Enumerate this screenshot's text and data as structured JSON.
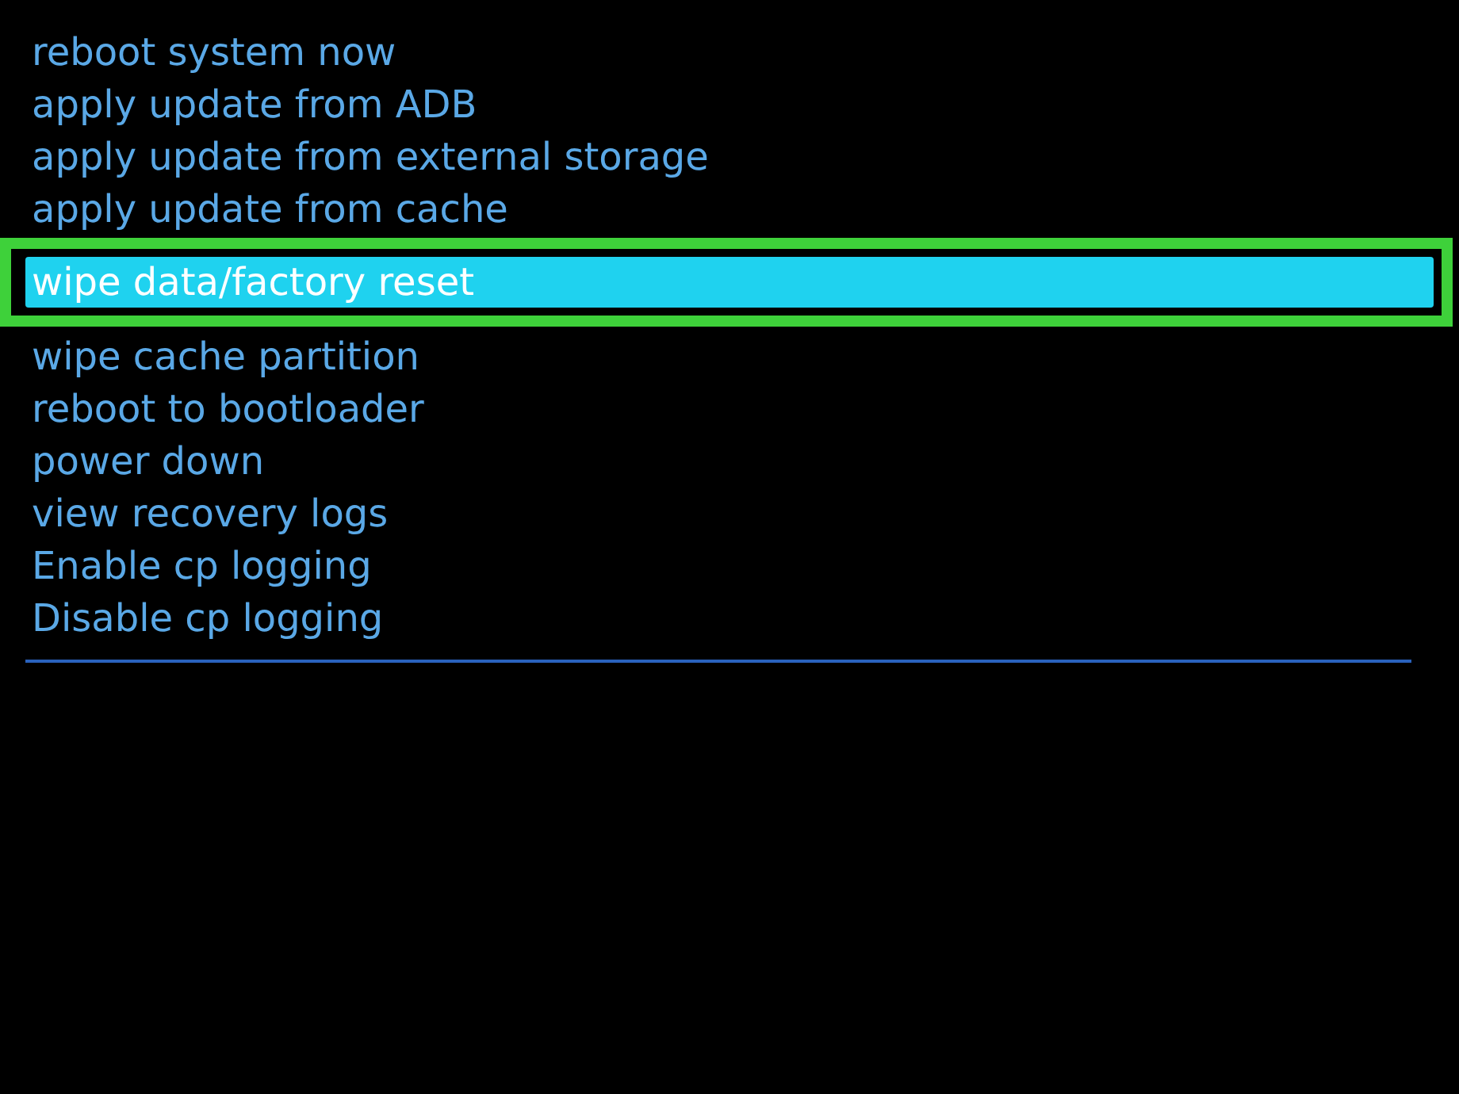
{
  "menu": {
    "items": [
      {
        "label": "reboot system now",
        "selected": false
      },
      {
        "label": "apply update from ADB",
        "selected": false
      },
      {
        "label": "apply update from external storage",
        "selected": false
      },
      {
        "label": "apply update from cache",
        "selected": false
      },
      {
        "label": "wipe data/factory reset",
        "selected": true
      },
      {
        "label": "wipe cache partition",
        "selected": false
      },
      {
        "label": "reboot to bootloader",
        "selected": false
      },
      {
        "label": "power down",
        "selected": false
      },
      {
        "label": "view recovery logs",
        "selected": false
      },
      {
        "label": "Enable cp logging",
        "selected": false
      },
      {
        "label": "Disable cp logging",
        "selected": false
      }
    ]
  }
}
